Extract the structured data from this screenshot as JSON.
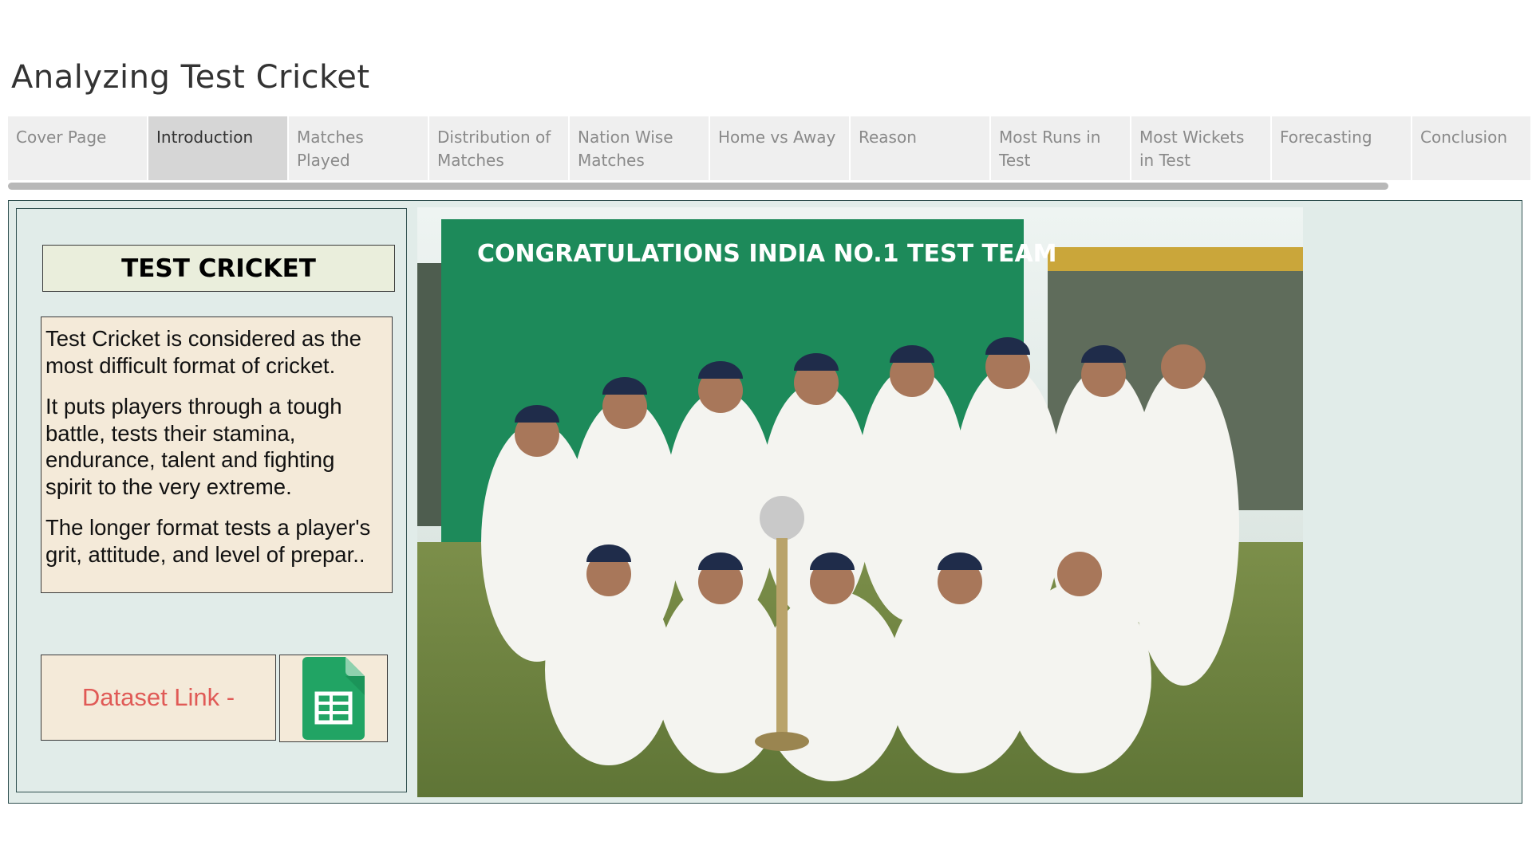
{
  "app": {
    "title": "Analyzing Test Cricket"
  },
  "tabs": [
    {
      "label": "Cover Page",
      "active": false
    },
    {
      "label": "Introduction",
      "active": true
    },
    {
      "label": "Matches Played",
      "active": false
    },
    {
      "label": "Distribution of Matches",
      "active": false
    },
    {
      "label": "Nation Wise Matches",
      "active": false
    },
    {
      "label": "Home vs Away",
      "active": false
    },
    {
      "label": "Reason",
      "active": false
    },
    {
      "label": "Most Runs in Test",
      "active": false
    },
    {
      "label": "Most Wickets in Test",
      "active": false
    },
    {
      "label": "Forecasting",
      "active": false
    },
    {
      "label": "Conclusion",
      "active": false
    }
  ],
  "intro": {
    "heading": "TEST CRICKET",
    "paragraphs": [
      "Test Cricket is considered as the most difficult format of cricket.",
      "It puts players through a tough battle, tests their stamina, endurance, talent and fighting spirit to the very extreme.",
      "The longer format tests a player's grit, attitude, and level of prepar.."
    ],
    "dataset_link_label": "Dataset Link -",
    "sheets_icon": "google-sheets-icon"
  },
  "photo": {
    "banner_text": "CONGRATULATIONS INDIA NO.1 TEST TEAM",
    "icon": "team-photo"
  },
  "colors": {
    "panel_bg": "#e1ece9",
    "text_box_bg": "#f4ead9",
    "heading_bg": "#eaeedc",
    "link_text": "#e05a56",
    "sheets_green": "#21a464",
    "active_tab": "#d6d6d6",
    "tab_bg": "#efefef"
  }
}
